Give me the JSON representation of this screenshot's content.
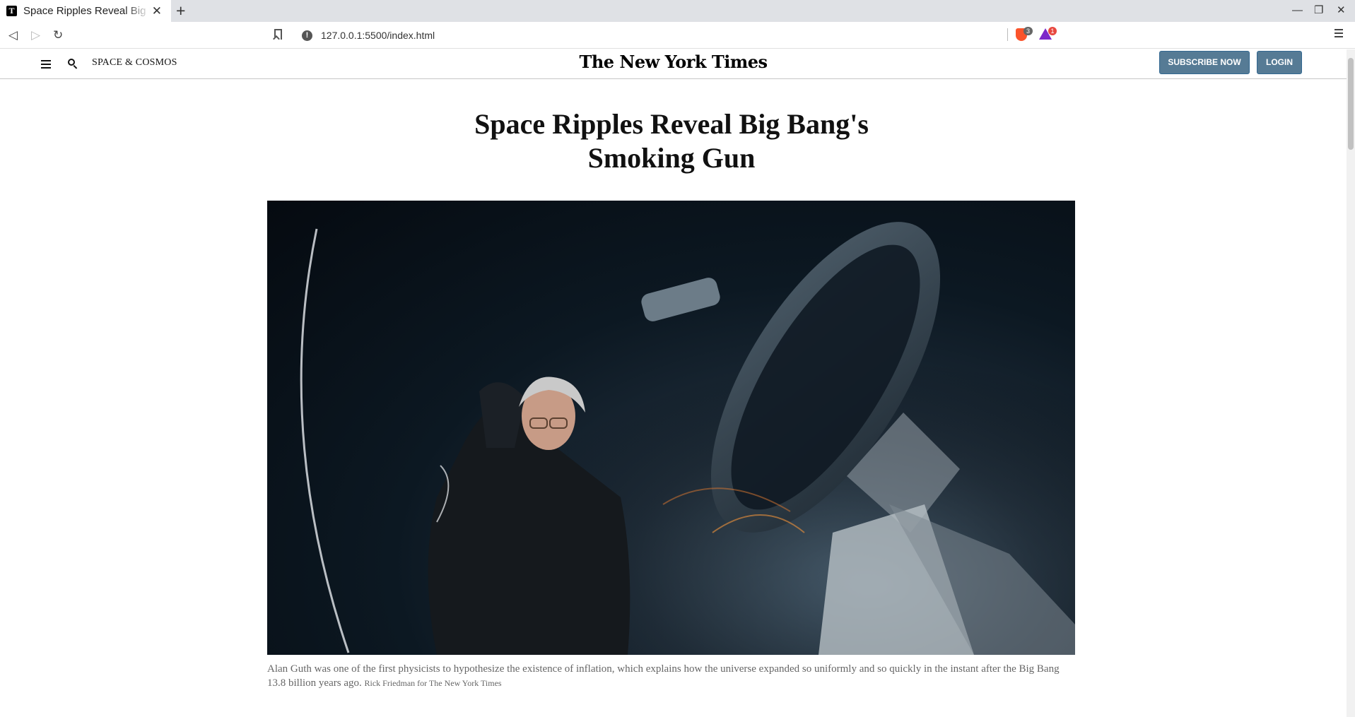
{
  "browser": {
    "tab_title": "Space Ripples Reveal Big Bang's Smoking Gun",
    "tab_favicon": "T",
    "new_tab_label": "+",
    "url": "127.0.0.1:5500/index.html",
    "brave_count": "3",
    "rewards_count": "1"
  },
  "header": {
    "section": "SPACE & COSMOS",
    "masthead": "The New York Times",
    "subscribe_label": "SUBSCRIBE NOW",
    "login_label": "LOGIN"
  },
  "article": {
    "headline_line1": "Space Ripples Reveal Big Bang's",
    "headline_line2": "Smoking Gun",
    "caption": "Alan Guth was one of the first physicists to hypothesize the existence of inflation, which explains how the universe expanded so uniformly and so quickly in the instant after the Big Bang 13.8 billion years ago.",
    "credit": "Rick Friedman for The New York Times"
  },
  "colors": {
    "button_bg": "#567b95",
    "rule": "#c7c7c7"
  },
  "icons": [
    "back-icon",
    "forward-icon",
    "reload-icon",
    "bookmark-icon",
    "info-icon",
    "brave-shield-icon",
    "brave-rewards-icon",
    "menu-icon",
    "hamburger-icon",
    "search-icon"
  ]
}
